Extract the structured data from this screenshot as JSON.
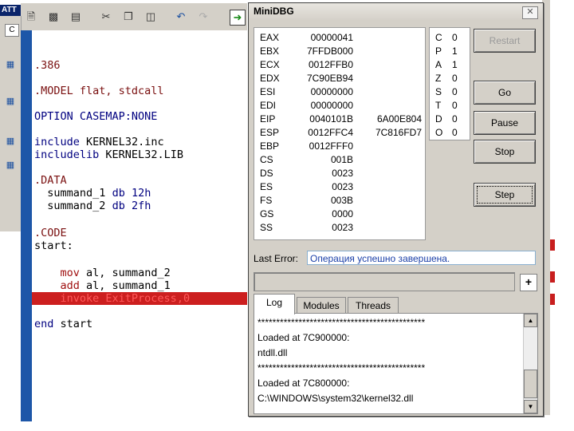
{
  "ide": {
    "title": "ATT",
    "left_tab": "C",
    "code": {
      "l1": ".386",
      "l2": ".MODEL flat, stdcall",
      "l3": "OPTION CASEMAP:NONE",
      "l4a": "include",
      "l4b": "KERNEL32.inc",
      "l5a": "includelib",
      "l5b": "KERNEL32.LIB",
      "l6": ".DATA",
      "l7a": "summand_1",
      "l7b": "db",
      "l7c": "12h",
      "l8a": "summand_2",
      "l8b": "db",
      "l8c": "2fh",
      "l9": ".CODE",
      "l10": "start:",
      "l11a": "mov",
      "l11b": "al, summand_2",
      "l12a": "add",
      "l12b": "al, summand_1",
      "l13": "invoke ExitProcess,0",
      "l14a": "end",
      "l14b": "start"
    }
  },
  "dialog": {
    "title": "MiniDBG",
    "registers": [
      {
        "name": "EAX",
        "value": "00000041",
        "extra": ""
      },
      {
        "name": "EBX",
        "value": "7FFDB000",
        "extra": ""
      },
      {
        "name": "ECX",
        "value": "0012FFB0",
        "extra": ""
      },
      {
        "name": "EDX",
        "value": "7C90EB94",
        "extra": ""
      },
      {
        "name": "ESI",
        "value": "00000000",
        "extra": ""
      },
      {
        "name": "EDI",
        "value": "00000000",
        "extra": ""
      },
      {
        "name": "EIP",
        "value": "0040101B",
        "extra": "6A00E804"
      },
      {
        "name": "ESP",
        "value": "0012FFC4",
        "extra": "7C816FD7"
      },
      {
        "name": "EBP",
        "value": "0012FFF0",
        "extra": ""
      },
      {
        "name": "CS",
        "value": "001B",
        "extra": ""
      },
      {
        "name": "DS",
        "value": "0023",
        "extra": ""
      },
      {
        "name": "ES",
        "value": "0023",
        "extra": ""
      },
      {
        "name": "FS",
        "value": "003B",
        "extra": ""
      },
      {
        "name": "GS",
        "value": "0000",
        "extra": ""
      },
      {
        "name": "SS",
        "value": "0023",
        "extra": ""
      }
    ],
    "flags": [
      {
        "name": "C",
        "value": "0"
      },
      {
        "name": "P",
        "value": "1"
      },
      {
        "name": "A",
        "value": "1"
      },
      {
        "name": "Z",
        "value": "0"
      },
      {
        "name": "S",
        "value": "0"
      },
      {
        "name": "T",
        "value": "0"
      },
      {
        "name": "D",
        "value": "0"
      },
      {
        "name": "O",
        "value": "0"
      }
    ],
    "buttons": {
      "restart": "Restart",
      "go": "Go",
      "pause": "Pause",
      "stop": "Stop",
      "step": "Step"
    },
    "last_error_label": "Last Error:",
    "last_error_value": "Операция успешно завершена.",
    "plus_label": "+",
    "tabs": {
      "log": "Log",
      "modules": "Modules",
      "threads": "Threads"
    },
    "log_lines": [
      "*********************************************",
      "Loaded at 7C900000:",
      "ntdll.dll",
      "*********************************************",
      "Loaded at 7C800000:",
      "C:\\WINDOWS\\system32\\kernel32.dll"
    ]
  }
}
